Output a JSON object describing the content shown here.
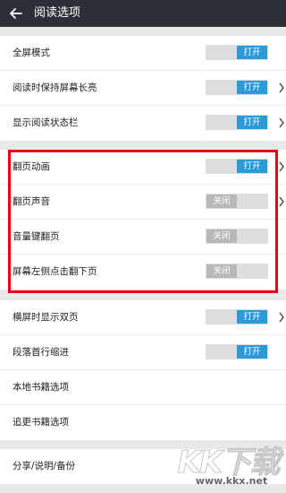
{
  "header": {
    "title": "阅读选项",
    "back_icon": "back-arrow-icon",
    "background": "#2b2f36"
  },
  "toggle_labels": {
    "on": "打开",
    "off": "关闭"
  },
  "colors": {
    "accent": "#2d9ad8",
    "highlight_border": "#e60012"
  },
  "groups": [
    {
      "items": [
        {
          "label": "全屏模式",
          "state": "on",
          "chevron": false
        },
        {
          "label": "阅读时保持屏幕长亮",
          "state": "on",
          "chevron": true
        },
        {
          "label": "显示阅读状态栏",
          "state": "on",
          "chevron": true
        }
      ]
    },
    {
      "items": [
        {
          "label": "翻页动画",
          "state": "on",
          "chevron": true
        },
        {
          "label": "翻页声音",
          "state": "off",
          "chevron": true
        },
        {
          "label": "音量键翻页",
          "state": "off",
          "chevron": false
        },
        {
          "label": "屏幕左侧点击翻下页",
          "state": "off",
          "chevron": false
        }
      ]
    },
    {
      "items": [
        {
          "label": "横屏时显示双页",
          "state": "on",
          "chevron": true
        },
        {
          "label": "段落首行缩进",
          "state": "on",
          "chevron": false
        },
        {
          "label": "本地书籍选项",
          "state": null,
          "chevron": false
        },
        {
          "label": "追更书籍选项",
          "state": null,
          "chevron": false
        }
      ]
    },
    {
      "items": [
        {
          "label": "分享/说明/备份",
          "state": null,
          "chevron": false
        }
      ]
    }
  ],
  "watermark": {
    "text": "KK下载",
    "url": "www.kkx.net"
  }
}
